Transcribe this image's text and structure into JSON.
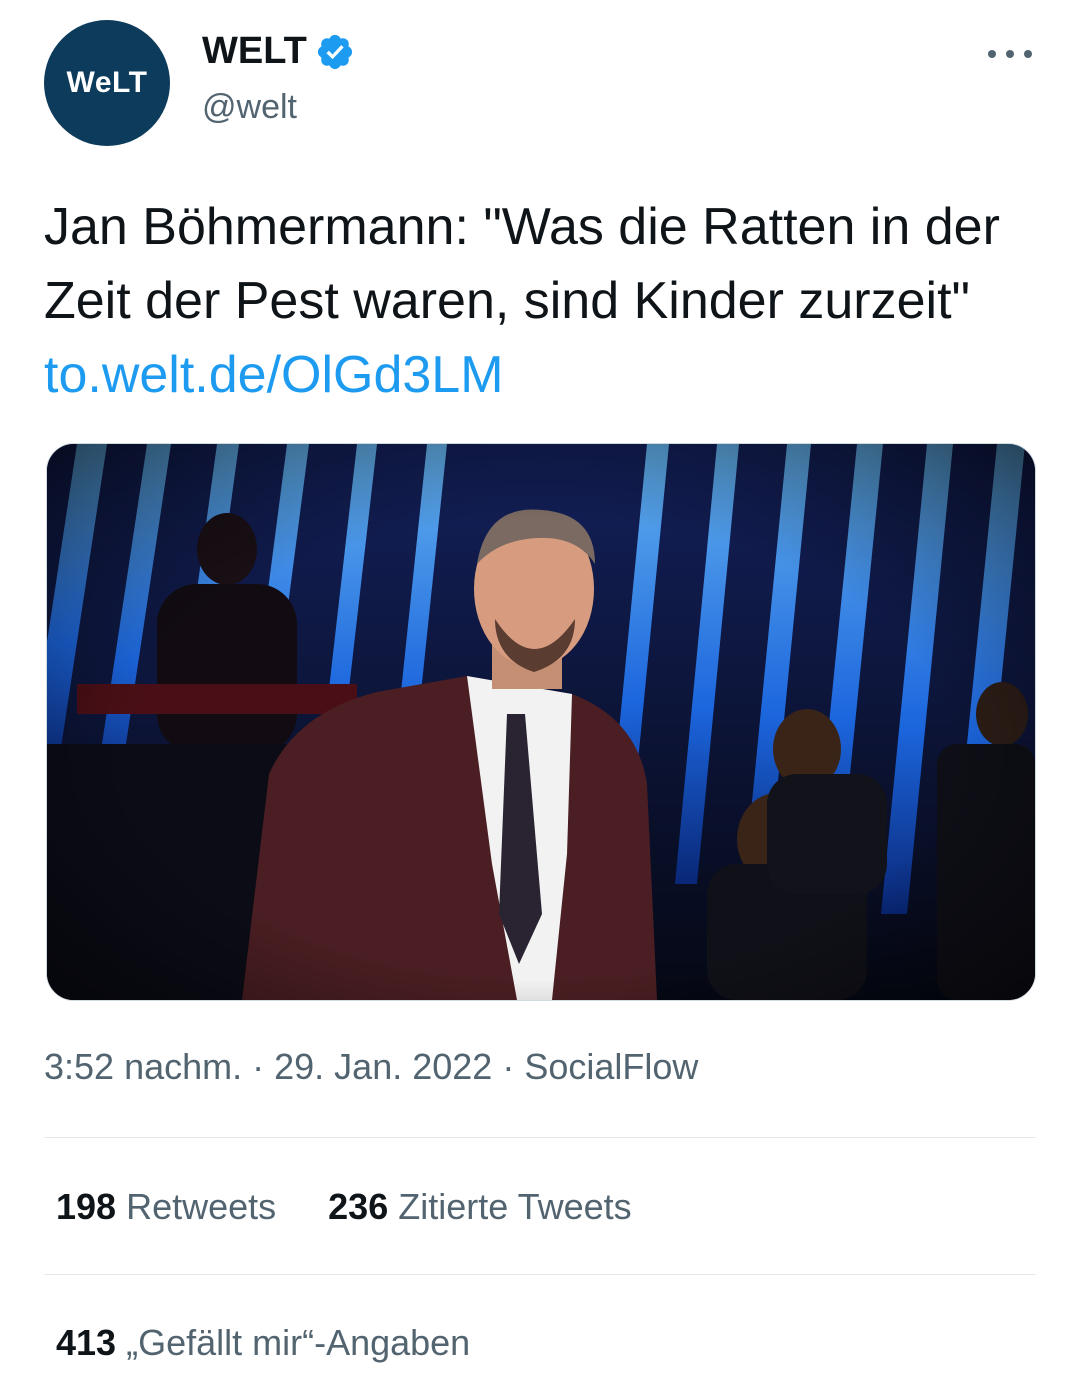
{
  "author": {
    "avatar_text": "WeLT",
    "display_name": "WELT",
    "handle": "@welt",
    "verified_icon": "verified-badge-icon",
    "verified_color": "#1d9bf0"
  },
  "tweet": {
    "text": "Jan Böhmermann: \"Was die Ratten in der Zeit der Pest waren, sind Kinder zurzeit\" ",
    "link": "to.welt.de/OlGd3LM"
  },
  "meta": {
    "time": "3:52 nachm.",
    "sep1": " · ",
    "date": "29. Jan. 2022",
    "sep2": " · ",
    "source": "SocialFlow"
  },
  "stats": {
    "retweets_count": "198",
    "retweets_label": "Retweets",
    "quotes_count": "236",
    "quotes_label": "Zitierte Tweets",
    "likes_count": "413",
    "likes_label": "„Gefällt mir“-Angaben"
  },
  "colors": {
    "accent": "#1d9bf0",
    "avatar_bg": "#0d3b5c"
  }
}
